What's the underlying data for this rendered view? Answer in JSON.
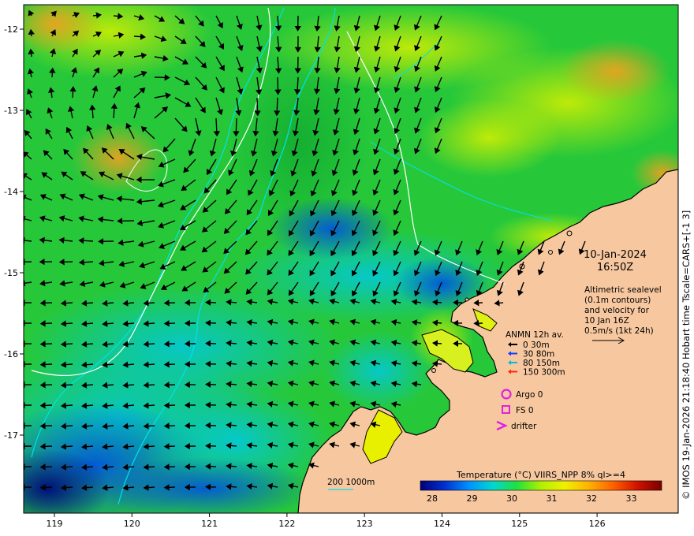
{
  "date": "10-Jan-2024",
  "time": "16:50Z",
  "description_lines": [
    "Altimetric sealevel",
    "(0.1m contours)",
    "and velocity for",
    "10 Jan 16Z",
    "0.5m/s (1kt 24h)"
  ],
  "anmn": {
    "title": "ANMN 12h av.",
    "items": [
      {
        "label": "0 30m",
        "color": "#000000"
      },
      {
        "label": "30 80m",
        "color": "#1040ff"
      },
      {
        "label": "80 150m",
        "color": "#00bcd4"
      },
      {
        "label": "150 300m",
        "color": "#ff2a00"
      }
    ]
  },
  "markers": [
    {
      "label": "Argo 0",
      "symbol": "circle",
      "color": "#e020e0"
    },
    {
      "label": "FS 0",
      "symbol": "square",
      "color": "#e020e0"
    },
    {
      "label": "drifter",
      "symbol": "chevron",
      "color": "#e020e0"
    }
  ],
  "bathy_label": "200  1000m",
  "colorbar": {
    "title": "Temperature (°C) VIIRS_NPP 8% ql>=4",
    "ticks": [
      "28",
      "29",
      "30",
      "31",
      "32",
      "33"
    ],
    "colors": [
      "#00007a",
      "#0030d0",
      "#0090ff",
      "#00d8d0",
      "#20e040",
      "#b0f000",
      "#f0f000",
      "#ffb000",
      "#ff6000",
      "#d01000",
      "#7a0000"
    ]
  },
  "axes": {
    "x_ticks": [
      "119",
      "120",
      "121",
      "122",
      "123",
      "124",
      "125",
      "126"
    ],
    "y_ticks": [
      "-12",
      "-13",
      "-14",
      "-15",
      "-16",
      "-17"
    ]
  },
  "side_caption": "© IMOS 19-Jan-2026 21:18:40 Hobart time Tscale=CARS+[-1 3]",
  "colors": {
    "land": "#f7c8a0",
    "sea_base": "#22c038",
    "arrow": "#000000",
    "contour": "#ffffff",
    "isobath": "#00e0f0"
  }
}
